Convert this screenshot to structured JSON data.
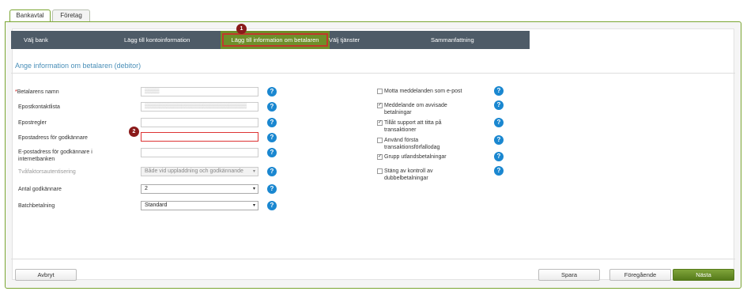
{
  "tabs": [
    {
      "label": "Bankavtal"
    },
    {
      "label": "Företag"
    }
  ],
  "steps": [
    {
      "label": "Välj bank"
    },
    {
      "label": "Lägg till kontoinformation"
    },
    {
      "label": "Lägg till information om betalaren"
    },
    {
      "label": "Välj tjänster"
    },
    {
      "label": "Sammanfattning"
    }
  ],
  "markers": {
    "one": "1",
    "two": "2"
  },
  "section_title": "Ange information om betalaren (debitor)",
  "form": {
    "payer_name": {
      "required_mark": "*",
      "label": "Betalarens namn",
      "value": "▒▒▒▒"
    },
    "email_list": {
      "label": "Epostkontaktlista",
      "value": "▒▒▒▒▒▒▒▒▒▒▒▒▒▒▒▒▒▒▒▒▒▒▒▒▒▒▒▒"
    },
    "email_rules": {
      "label": "Epostregler",
      "value": ""
    },
    "approver_email": {
      "label": "Epostadress för godkännare",
      "value": ""
    },
    "approver_email_bank": {
      "label": "E-postadress för godkännare i internetbanken",
      "value": ""
    },
    "two_factor": {
      "label": "Tvåfaktorsautentisering",
      "value": "Både vid uppladdning och godkännande"
    },
    "approver_count": {
      "label": "Antal godkännare",
      "value": "2"
    },
    "batch_payment": {
      "label": "Batchbetalning",
      "value": "Standard"
    }
  },
  "options": [
    {
      "label": "Motta meddelanden som e-post",
      "checked": false
    },
    {
      "label": "Meddelande om avvisade betalningar",
      "checked": true
    },
    {
      "label": "Tillåt support att titta på transaktioner",
      "checked": true
    },
    {
      "label": "Använd första transaktionsförfallodag",
      "checked": false
    },
    {
      "label": "Grupp utlandsbetalningar",
      "checked": true
    },
    {
      "label": "Stäng av kontroll av dubbelbetalningar",
      "checked": false
    }
  ],
  "help_glyph": "?",
  "check_glyph": "✓",
  "dropdown_glyph": "▾",
  "buttons": {
    "cancel": "Avbryt",
    "save": "Spara",
    "previous": "Föregående",
    "next": "Nästa"
  },
  "colors": {
    "accent_green": "#6e8f2a",
    "help_blue": "#1a87d0",
    "error_red": "#d33",
    "step_bar": "#4e5b67"
  }
}
